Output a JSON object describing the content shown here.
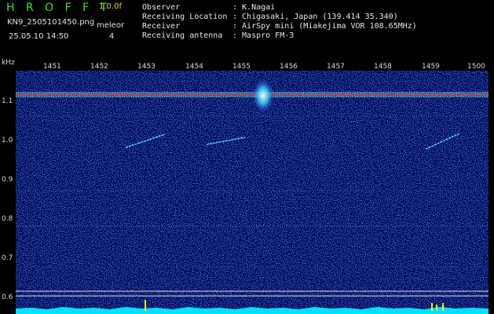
{
  "header": {
    "title": "H R O F F T",
    "version": "1.0.0f",
    "filename": "KN9_2505101450.png",
    "mode": "meleor",
    "datetime": "25.05.10 14:50",
    "count": "4",
    "info": [
      {
        "label": "Observer",
        "value": ": K.Nagai"
      },
      {
        "label": "Receiving Location",
        "value": ": Chigasaki, Japan (139.414 35.340)"
      },
      {
        "label": "Receiver",
        "value": ": AirSpy mini (Miakejima VOR 108.65MHz)"
      },
      {
        "label": "Receiving antenna",
        "value": ": Maspro FM-3"
      }
    ]
  },
  "plot": {
    "unit": "kHz",
    "time_ticks": [
      "1451",
      "1452",
      "1453",
      "1454",
      "1455",
      "1456",
      "1457",
      "1458",
      "1459",
      "1500"
    ],
    "freq_ticks": [
      "1.1",
      "1.0",
      "0.9",
      "0.8",
      "0.7",
      "0.6"
    ],
    "colors": {
      "background": "#00004a",
      "noise": "#1a3cff",
      "carrier": "#ff4040",
      "bottom_trace": "#00e0ff",
      "marker": "#ffee00"
    }
  }
}
